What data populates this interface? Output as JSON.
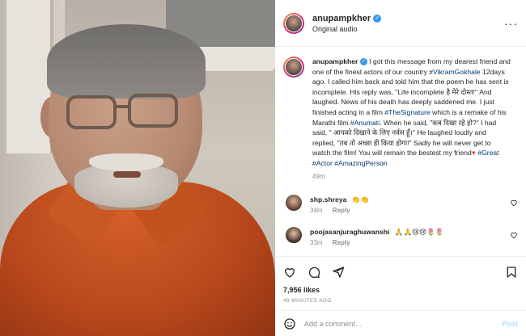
{
  "header": {
    "username": "anupampkher",
    "subtitle": "Original audio",
    "more_icon": "more-horizontal-icon"
  },
  "caption": {
    "username": "anupampkher",
    "text_1": "I got this message from my dearest friend and one of the finest actors of our country ",
    "tag_vikram": "#VikramGokhale",
    "text_2": " 12days ago. I called him back and told him that the poem he has sent is incomplete. His reply was, \"Life incomplete है मेरे दोस्त!\" And laughed. News of his death has deeply saddened me. I just finished acting in a film ",
    "tag_signature": "#TheSignature",
    "text_3": " which is a remake of his Marathi film ",
    "tag_anumati": "#Anumati",
    "text_4": ". When he said, \"कब दिखा रहे हो?\" I had said, \" आपको दिखाने के लिए नर्वस हूँ।\" He laughed loudly and replied, \"तब तो अच्छा ही किया होगा!\" Sadly he will never get to watch the film! You will remain the bestest my friend",
    "heart": "♥",
    "tag_great": "#Great",
    "tag_actor": "#Actor",
    "tag_amazing": "#AmazingPerson",
    "time": "49m"
  },
  "comments": [
    {
      "username": "shp.shreya",
      "text": "👏👏",
      "time": "34m",
      "reply": "Reply"
    },
    {
      "username": "poojasanjuraghuwanshi",
      "text": "🙏🙏😢😢🌷🌷",
      "time": "33m",
      "reply": "Reply"
    }
  ],
  "actions": {
    "likes": "7,956 likes",
    "posted": "49 MINUTES AGO"
  },
  "composer": {
    "placeholder": "Add a comment...",
    "post_label": "Post"
  },
  "colors": {
    "link": "#00376b",
    "verified": "#3897f0",
    "muted": "#8e8e8e",
    "post_disabled": "#b2dffc"
  }
}
